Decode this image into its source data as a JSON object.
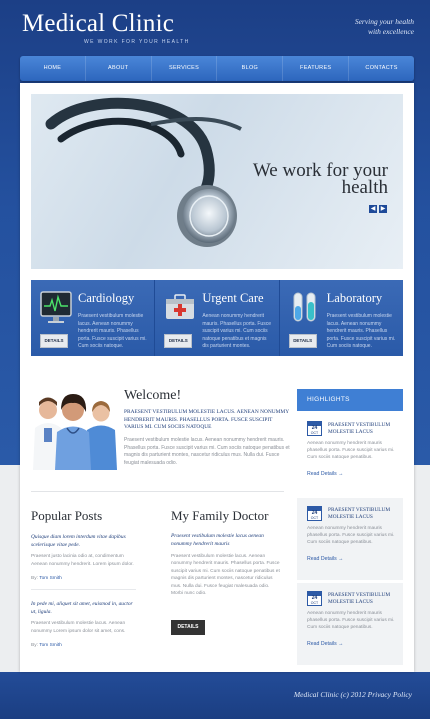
{
  "header": {
    "logo": "Medical Clinic",
    "tagline": "WE WORK FOR YOUR HEALTH",
    "slogan_line1": "Serving your health",
    "slogan_line2": "with excellence"
  },
  "nav": [
    "HOME",
    "ABOUT",
    "SERVICES",
    "BLOG",
    "FEATURES",
    "CONTACTS"
  ],
  "hero": {
    "title_line1": "We work for your",
    "title_line2": "health",
    "prev": "◀",
    "next": "▶"
  },
  "services": [
    {
      "title": "Cardiology",
      "text": "Praesent vestibulum molestie lacus. Aenean nonummy hendrerit mauris. Phasellus porta. Fusce suscipit varius mi. Cum sociis natoque.",
      "button": "DETAILS",
      "icon": "monitor-icon"
    },
    {
      "title": "Urgent Care",
      "text": "Aenean nonummy hendrerit mauris. Phasellus porta. Fusce suscipit varius mi. Cum sociis natoque penatibus et magnis dis parturient montes.",
      "button": "DETAILS",
      "icon": "first-aid-kit-icon"
    },
    {
      "title": "Laboratory",
      "text": "Praesent vestibulum molestie lacus. Aenean nonummy hendrerit mauris. Phasellus porta. Fusce suscipit varius mi. Cum sociis natoque.",
      "button": "DETAILS",
      "icon": "test-tubes-icon"
    }
  ],
  "welcome": {
    "title": "Welcome!",
    "lead": "PRAESENT VESTIBULUM MOLESTIE LACUS. AENEAN NONUMMY HENDRERIT MAURIS. PHASELLUS PORTA. FUSCE SUSCIPIT VARIUS MI. CUM SOCIIS NATOQUE",
    "text": "Praesent vestibulum molestie lacus. Aenean nonummy hendrerit mauris. Phasellus porta. Fusce suscipit varius mi. Cum sociis natoque penatibus et magnis dis parturient montes, nascetur ridiculus mus. Nulla dui. Fusce feugiat malesuada odio."
  },
  "highlights": {
    "title": "HIGHLIGHTS",
    "items": [
      {
        "day": "24",
        "month": "OCT",
        "title": "PRAESENT VESTIBULUM MOLESTIE LACUS",
        "text": "Aenean nonummy hendrerit mauris phasellus porta. Fusce suscipit varius mi. Cum sociis natoque penatibus.",
        "more": "Read Details →"
      },
      {
        "day": "24",
        "month": "OCT",
        "title": "PRAESENT VESTIBULUM MOLESTIE LACUS",
        "text": "Aenean nonummy hendrerit mauris phasellus porta. Fusce suscipit varius mi. Cum sociis natoque penatibus.",
        "more": "Read Details →"
      },
      {
        "day": "24",
        "month": "OCT",
        "title": "PRAESENT VESTIBULUM MOLESTIE LACUS",
        "text": "Aenean nonummy hendrerit mauris phasellus porta. Fusce suscipit varius mi. Cum sociis natoque penatibus.",
        "more": "Read Details →"
      }
    ]
  },
  "popular_posts": {
    "title": "Popular Posts",
    "posts": [
      {
        "quote": "Quisque diam lorem interdum vitae dapibus scelerisque vitae pede.",
        "text": "Praesent justo lacinia odio at, condimentum Aenean nonummy hendrerit. Lorem ipsum dolor.",
        "by_label": "By:",
        "author": "Tom Smith"
      },
      {
        "quote": "In pede mi, aliquet sit amet, euismod in, auctor ut, ligula.",
        "text": "Praesent vestibulum molestie lacus. Aenean nonummy Lorem ipsum dolor sit amet, cons.",
        "by_label": "By:",
        "author": "Tom Smith"
      }
    ]
  },
  "family_doctor": {
    "title": "My Family Doctor",
    "lead": "Praesent vestibulum molestie lacus aenean nonummy hendrerit mauris",
    "text": "Praesent vestibulum molestie lacus. Aenean nonummy hendrerit mauris. Phasellus porta. Fusce suscipit varius mi. Cum sociis natoque penatibus et magnis dis parturient montes, nascetur ridiculus mus. Nulla dui. Fusce feugiat malesuada odio. Morbi nunc odio.",
    "button": "DETAILS"
  },
  "footer": {
    "text": "Medical Clinic (c) 2012  Privacy Policy"
  }
}
